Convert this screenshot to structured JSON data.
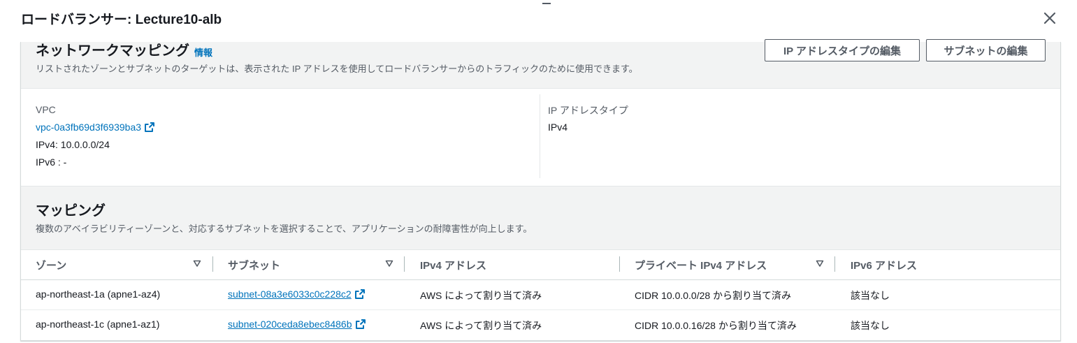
{
  "modal": {
    "title": "ロードバランサー: Lecture10-alb"
  },
  "network_mapping": {
    "title": "ネットワークマッピング",
    "info_link": "情報",
    "description": "リストされたゾーンとサブネットのターゲットは、表示された IP アドレスを使用してロードバランサーからのトラフィックのために使用できます。",
    "buttons": {
      "edit_ip_type": "IP アドレスタイプの編集",
      "edit_subnets": "サブネットの編集"
    },
    "vpc": {
      "label": "VPC",
      "id": "vpc-0a3fb69d3f6939ba3",
      "ipv4": "IPv4: 10.0.0.0/24",
      "ipv6": "IPv6 : -"
    },
    "ip_address_type": {
      "label": "IP アドレスタイプ",
      "value": "IPv4"
    }
  },
  "mappings": {
    "title": "マッピング",
    "description": "複数のアベイラビリティーゾーンと、対応するサブネットを選択することで、アプリケーションの耐障害性が向上します。",
    "columns": [
      "ゾーン",
      "サブネット",
      "IPv4 アドレス",
      "プライベート IPv4 アドレス",
      "IPv6 アドレス"
    ],
    "rows": [
      {
        "zone": "ap-northeast-1a (apne1-az4)",
        "subnet": "subnet-08a3e6033c0c228c2",
        "ipv4": "AWS によって割り当て済み",
        "private_ipv4": "CIDR 10.0.0.0/28 から割り当て済み",
        "ipv6": "該当なし"
      },
      {
        "zone": "ap-northeast-1c (apne1-az1)",
        "subnet": "subnet-020ceda8ebec8486b",
        "ipv4": "AWS によって割り当て済み",
        "private_ipv4": "CIDR 10.0.0.16/28 から割り当て済み",
        "ipv6": "該当なし"
      }
    ]
  },
  "icons": {
    "close": "close-icon",
    "external_link": "external-link-icon",
    "sort": "sort-down-icon"
  },
  "colors": {
    "link": "#0073bb",
    "header_bg": "#f2f3f3",
    "text": "#16191f",
    "muted": "#545b64"
  }
}
